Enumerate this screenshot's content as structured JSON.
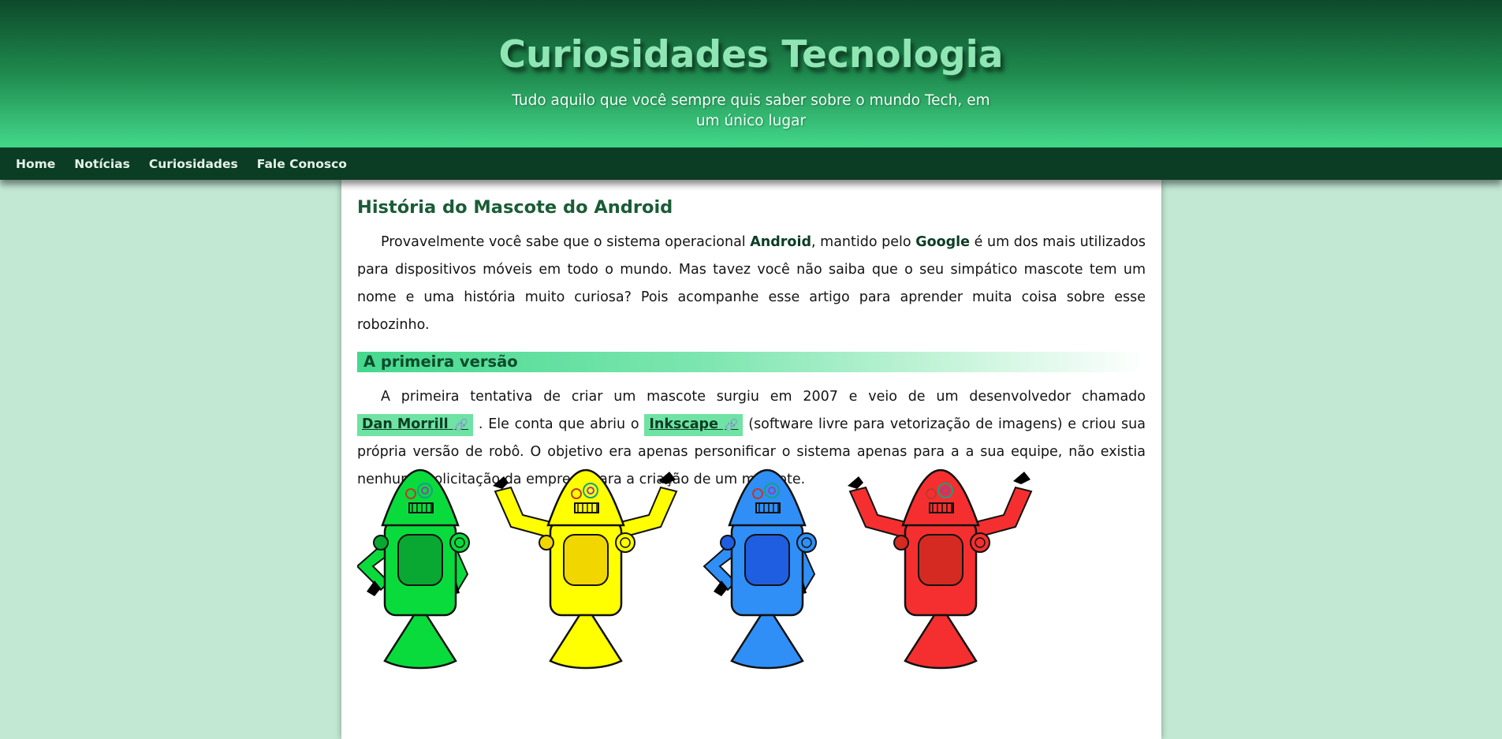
{
  "header": {
    "title": "Curiosidades Tecnologia",
    "subtitle": "Tudo aquilo que você sempre quis saber sobre o mundo Tech, em um único lugar"
  },
  "nav": {
    "items": [
      {
        "label": "Home"
      },
      {
        "label": "Notícias"
      },
      {
        "label": "Curiosidades"
      },
      {
        "label": "Fale Conosco"
      }
    ]
  },
  "article": {
    "title": "História do Mascote do Android",
    "intro": {
      "t1": "Provavelmente você sabe que o sistema operacional ",
      "b1": "Android",
      "t2": ", mantido pelo ",
      "b2": "Google",
      "t3": " é um dos mais utilizados para dispositivos móveis em todo o mundo. Mas tavez você não saiba que o seu simpático mascote tem um nome e uma história muito curiosa? Pois acompanhe esse artigo para aprender muita coisa sobre esse robozinho."
    },
    "section1": {
      "heading": "A primeira versão",
      "t1": "A primeira tentativa de criar um mascote surgiu em 2007 e veio de um desenvolvedor chamado ",
      "link1": "Dan Morrill",
      "t2": " . Ele conta que abriu o ",
      "link2": "Inkscape",
      "t3": " (software livre para vetorização de imagens) e criou sua própria versão de robô. O objetivo era apenas personificar o sistema apenas para a a sua equipe, não existia nenhuma solicitação da empresa para a criação de um mascote.",
      "link_icon": "🔗"
    },
    "image": {
      "robots": [
        {
          "color": "#0adb3c",
          "shade": "#08a832"
        },
        {
          "color": "#ffff00",
          "shade": "#f2d600"
        },
        {
          "color": "#2f8ff7",
          "shade": "#1f5ee0"
        },
        {
          "color": "#f52f2f",
          "shade": "#d42a22"
        }
      ]
    }
  }
}
